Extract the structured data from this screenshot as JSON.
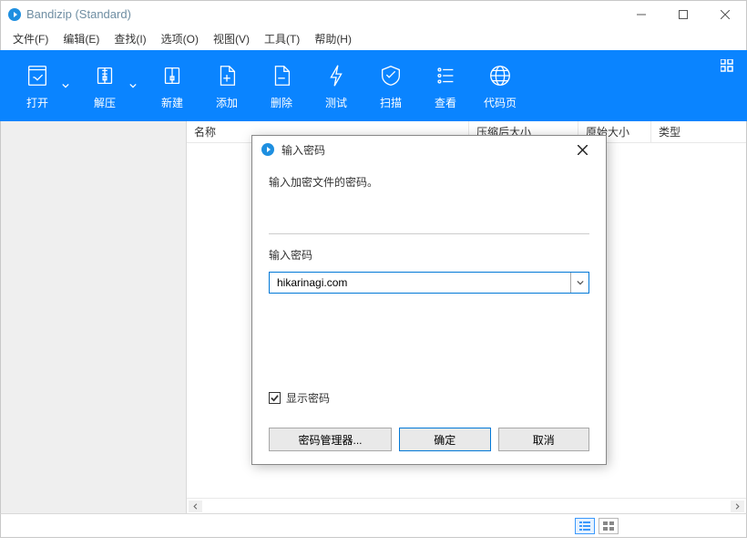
{
  "title": "Bandizip (Standard)",
  "menu": {
    "file": "文件(F)",
    "edit": "编辑(E)",
    "find": "查找(I)",
    "options": "选项(O)",
    "view": "视图(V)",
    "tools": "工具(T)",
    "help": "帮助(H)"
  },
  "toolbar": {
    "open": "打开",
    "extract": "解压",
    "new": "新建",
    "add": "添加",
    "delete": "删除",
    "test": "测试",
    "scan": "扫描",
    "view": "查看",
    "codepage": "代码页"
  },
  "columns": {
    "name": "名称",
    "packed": "压缩后大小",
    "original": "原始大小",
    "type": "类型"
  },
  "dialog": {
    "title": "输入密码",
    "instruction": "输入加密文件的密码。",
    "field_label": "输入密码",
    "value": "hikarinagi.com",
    "show_password": "显示密码",
    "show_password_checked": true,
    "manager": "密码管理器...",
    "ok": "确定",
    "cancel": "取消"
  }
}
